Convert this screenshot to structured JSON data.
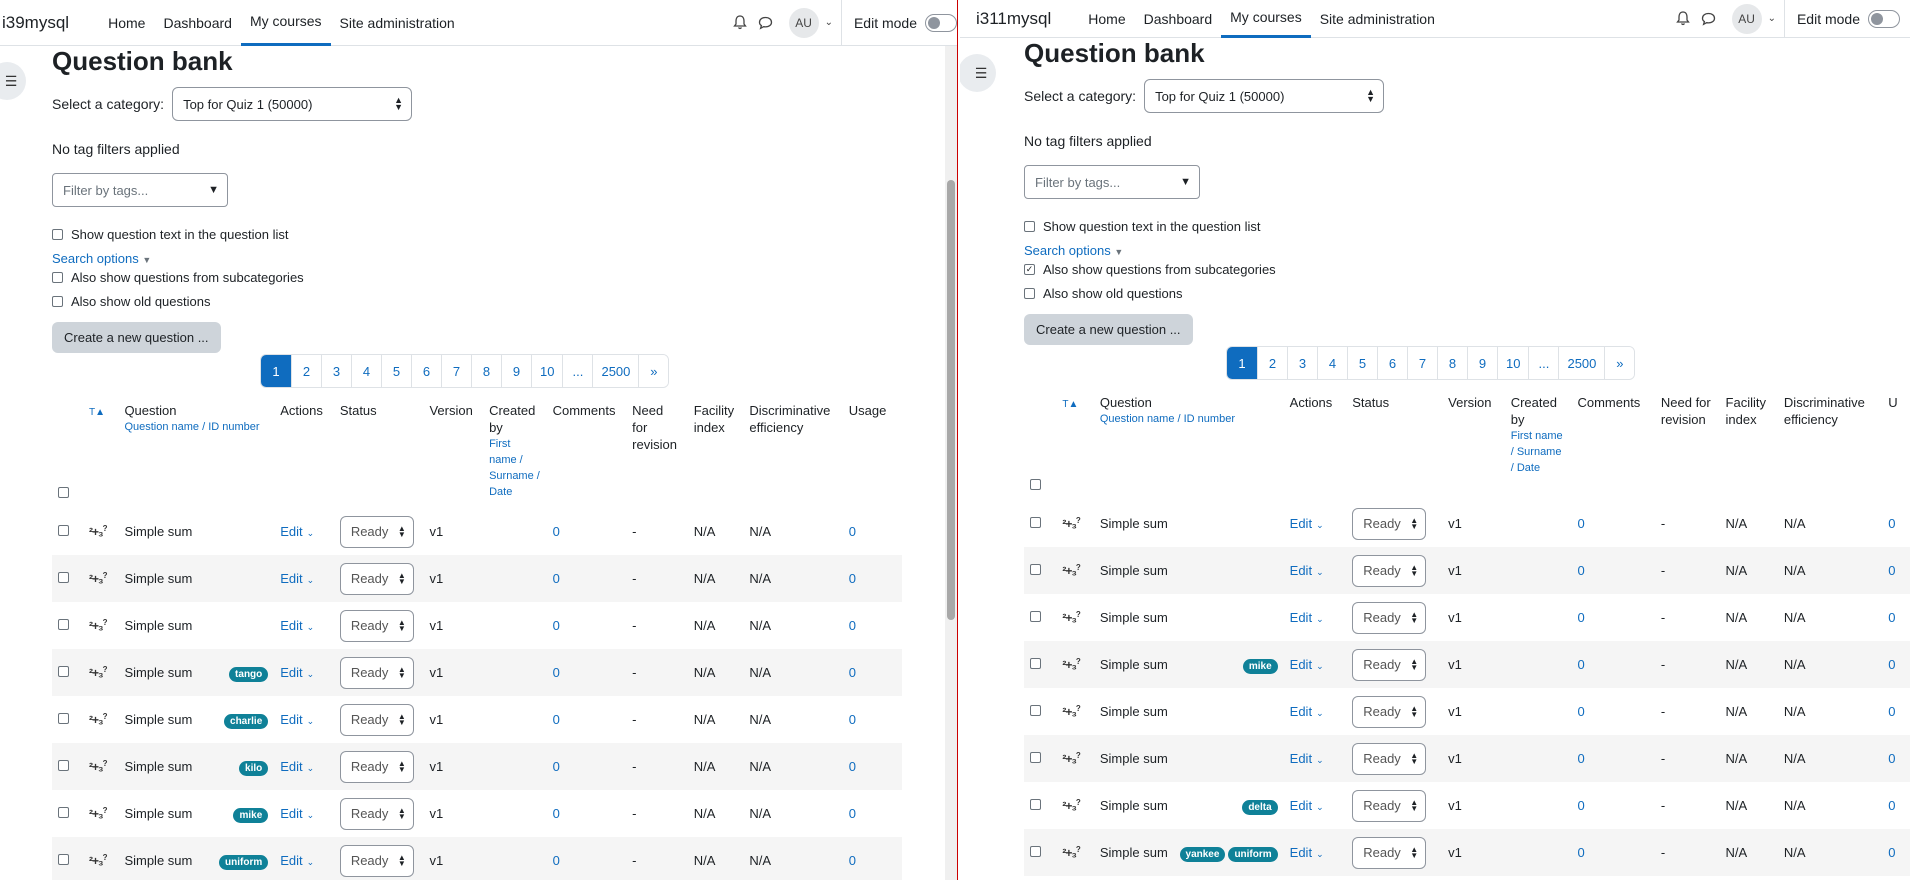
{
  "left": {
    "site_name": "i39mysql",
    "nav": [
      "Home",
      "Dashboard",
      "My courses",
      "Site administration"
    ],
    "active_nav": "My courses",
    "avatar": "AU",
    "edit_mode_label": "Edit mode",
    "page_title": "Question bank",
    "category_label": "Select a category:",
    "category_value": "Top for Quiz 1 (50000)",
    "no_tags": "No tag filters applied",
    "filter_placeholder": "Filter by tags...",
    "show_text_label": "Show question text in the question list",
    "search_options": "Search options",
    "subcat_label": "Also show questions from subcategories",
    "subcat_checked": false,
    "old_label": "Also show old questions",
    "create_button": "Create a new question ...",
    "pages": [
      "1",
      "2",
      "3",
      "4",
      "5",
      "6",
      "7",
      "8",
      "9",
      "10",
      "...",
      "2500",
      "»"
    ],
    "headers": {
      "type": "T",
      "question": "Question",
      "question_sub": "Question name / ID number",
      "actions": "Actions",
      "status": "Status",
      "version": "Version",
      "created": "Created by",
      "created_sub": "First name / Surname / Date",
      "comments": "Comments",
      "need": "Need for revision",
      "facility": "Facility index",
      "discrim": "Discriminative efficiency",
      "usage": "Usage"
    },
    "rows": [
      {
        "name": "Simple sum",
        "tags": [],
        "action": "Edit",
        "status": "Ready",
        "version": "v1",
        "comments": "0",
        "need": "-",
        "facility": "N/A",
        "discrim": "N/A",
        "usage": "0"
      },
      {
        "name": "Simple sum",
        "tags": [],
        "action": "Edit",
        "status": "Ready",
        "version": "v1",
        "comments": "0",
        "need": "-",
        "facility": "N/A",
        "discrim": "N/A",
        "usage": "0"
      },
      {
        "name": "Simple sum",
        "tags": [],
        "action": "Edit",
        "status": "Ready",
        "version": "v1",
        "comments": "0",
        "need": "-",
        "facility": "N/A",
        "discrim": "N/A",
        "usage": "0"
      },
      {
        "name": "Simple sum",
        "tags": [
          "tango"
        ],
        "action": "Edit",
        "status": "Ready",
        "version": "v1",
        "comments": "0",
        "need": "-",
        "facility": "N/A",
        "discrim": "N/A",
        "usage": "0"
      },
      {
        "name": "Simple sum",
        "tags": [
          "charlie"
        ],
        "action": "Edit",
        "status": "Ready",
        "version": "v1",
        "comments": "0",
        "need": "-",
        "facility": "N/A",
        "discrim": "N/A",
        "usage": "0"
      },
      {
        "name": "Simple sum",
        "tags": [
          "kilo"
        ],
        "action": "Edit",
        "status": "Ready",
        "version": "v1",
        "comments": "0",
        "need": "-",
        "facility": "N/A",
        "discrim": "N/A",
        "usage": "0"
      },
      {
        "name": "Simple sum",
        "tags": [
          "mike"
        ],
        "action": "Edit",
        "status": "Ready",
        "version": "v1",
        "comments": "0",
        "need": "-",
        "facility": "N/A",
        "discrim": "N/A",
        "usage": "0"
      },
      {
        "name": "Simple sum",
        "tags": [
          "uniform"
        ],
        "action": "Edit",
        "status": "Ready",
        "version": "v1",
        "comments": "0",
        "need": "-",
        "facility": "N/A",
        "discrim": "N/A",
        "usage": "0"
      }
    ]
  },
  "right": {
    "site_name": "i311mysql",
    "nav": [
      "Home",
      "Dashboard",
      "My courses",
      "Site administration"
    ],
    "active_nav": "My courses",
    "avatar": "AU",
    "edit_mode_label": "Edit mode",
    "page_title": "Question bank",
    "category_label": "Select a category:",
    "category_value": "Top for Quiz 1 (50000)",
    "no_tags": "No tag filters applied",
    "filter_placeholder": "Filter by tags...",
    "show_text_label": "Show question text in the question list",
    "search_options": "Search options",
    "subcat_label": "Also show questions from subcategories",
    "subcat_checked": true,
    "old_label": "Also show old questions",
    "create_button": "Create a new question ...",
    "pages": [
      "1",
      "2",
      "3",
      "4",
      "5",
      "6",
      "7",
      "8",
      "9",
      "10",
      "...",
      "2500",
      "»"
    ],
    "headers": {
      "type": "T",
      "question": "Question",
      "question_sub": "Question name / ID number",
      "actions": "Actions",
      "status": "Status",
      "version": "Version",
      "created": "Created by",
      "created_sub": "First name / Surname / Date",
      "comments": "Comments",
      "need": "Need for revision",
      "facility": "Facility index",
      "discrim": "Discriminative efficiency",
      "usage": "U"
    },
    "rows": [
      {
        "name": "Simple sum",
        "tags": [],
        "action": "Edit",
        "status": "Ready",
        "version": "v1",
        "comments": "0",
        "need": "-",
        "facility": "N/A",
        "discrim": "N/A",
        "usage": "0"
      },
      {
        "name": "Simple sum",
        "tags": [],
        "action": "Edit",
        "status": "Ready",
        "version": "v1",
        "comments": "0",
        "need": "-",
        "facility": "N/A",
        "discrim": "N/A",
        "usage": "0"
      },
      {
        "name": "Simple sum",
        "tags": [],
        "action": "Edit",
        "status": "Ready",
        "version": "v1",
        "comments": "0",
        "need": "-",
        "facility": "N/A",
        "discrim": "N/A",
        "usage": "0"
      },
      {
        "name": "Simple sum",
        "tags": [
          "mike"
        ],
        "action": "Edit",
        "status": "Ready",
        "version": "v1",
        "comments": "0",
        "need": "-",
        "facility": "N/A",
        "discrim": "N/A",
        "usage": "0"
      },
      {
        "name": "Simple sum",
        "tags": [],
        "action": "Edit",
        "status": "Ready",
        "version": "v1",
        "comments": "0",
        "need": "-",
        "facility": "N/A",
        "discrim": "N/A",
        "usage": "0"
      },
      {
        "name": "Simple sum",
        "tags": [],
        "action": "Edit",
        "status": "Ready",
        "version": "v1",
        "comments": "0",
        "need": "-",
        "facility": "N/A",
        "discrim": "N/A",
        "usage": "0"
      },
      {
        "name": "Simple sum",
        "tags": [
          "delta"
        ],
        "action": "Edit",
        "status": "Ready",
        "version": "v1",
        "comments": "0",
        "need": "-",
        "facility": "N/A",
        "discrim": "N/A",
        "usage": "0"
      },
      {
        "name": "Simple sum",
        "tags": [
          "yankee",
          "uniform"
        ],
        "action": "Edit",
        "status": "Ready",
        "version": "v1",
        "comments": "0",
        "need": "-",
        "facility": "N/A",
        "discrim": "N/A",
        "usage": "0"
      }
    ]
  },
  "icons": {
    "bell": "bell-icon",
    "messages": "chat-icon",
    "drawer": "list-icon",
    "qtype": "calculated-question-icon"
  },
  "colors": {
    "accent": "#0f6cbf",
    "tag": "#0f8198",
    "button_secondary": "#ced4da"
  }
}
